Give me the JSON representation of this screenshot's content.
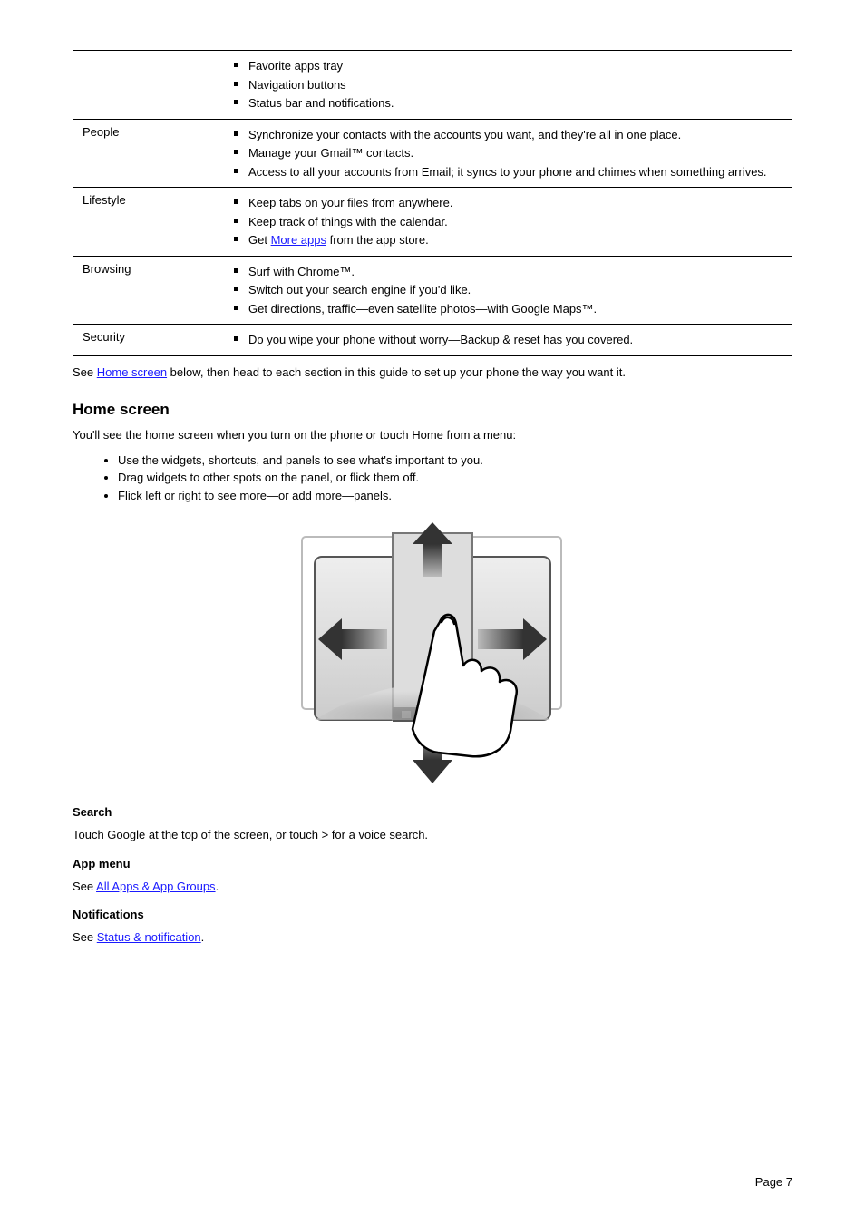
{
  "table": {
    "rows": [
      {
        "label": "",
        "items": [
          {
            "text": "Favorite apps tray",
            "sub": false
          },
          {
            "text": "Navigation buttons",
            "sub": false
          },
          {
            "text": "Status bar and notifications.",
            "sub": false
          }
        ]
      },
      {
        "label": "People",
        "items": [
          {
            "text": "Synchronize your contacts with the accounts you want, and they're all in one place.",
            "sub": false
          },
          {
            "text": "Manage your Gmail™ contacts.",
            "sub": false
          },
          {
            "text": "Access to all your accounts from Email; it syncs to your phone and chimes when something arrives.",
            "sub": false
          }
        ]
      },
      {
        "label": "Lifestyle",
        "items": [
          {
            "text": "Keep tabs on your files from anywhere.",
            "sub": false
          },
          {
            "text": "Keep track of things with the calendar.",
            "sub": false
          },
          {
            "prefix": "Get ",
            "link": "More apps",
            "suffix": " from the app store.",
            "sub": false
          }
        ]
      },
      {
        "label": "Browsing",
        "items": [
          {
            "text": "Surf with Chrome™.",
            "sub": false
          },
          {
            "text": "Switch out your search engine if you'd like.",
            "sub": false
          },
          {
            "text": "Get directions, traffic—even satellite photos—with Google Maps™.",
            "sub": false
          }
        ]
      },
      {
        "label": "Security",
        "items": [
          {
            "text": "Do you wipe your phone without worry—Backup & reset has you covered.",
            "sub": false
          }
        ]
      }
    ]
  },
  "para1": {
    "prefix": "See ",
    "link": "Home screen",
    "suffix": " below, then head to each section in this guide to set up your phone the way you want it."
  },
  "heading": "Home screen",
  "intro": "You'll see the home screen when you turn on the phone or touch Home from a menu:",
  "bullets": [
    "Use the widgets, shortcuts, and panels to see what's important to you.",
    "Drag widgets to other spots on the panel, or flick them off.",
    "Flick left or right to see more—or add more—panels."
  ],
  "sub1": {
    "title": "Search",
    "text": "Touch Google at the top of the screen, or touch > for a voice search."
  },
  "sub2": {
    "title": "App menu",
    "prefix": "See ",
    "link": "All Apps & App Groups",
    "suffix": "."
  },
  "sub3": {
    "title": "Notifications",
    "prefix": "See ",
    "link": "Status & notification",
    "suffix": "."
  },
  "pagenum": "Page 7"
}
